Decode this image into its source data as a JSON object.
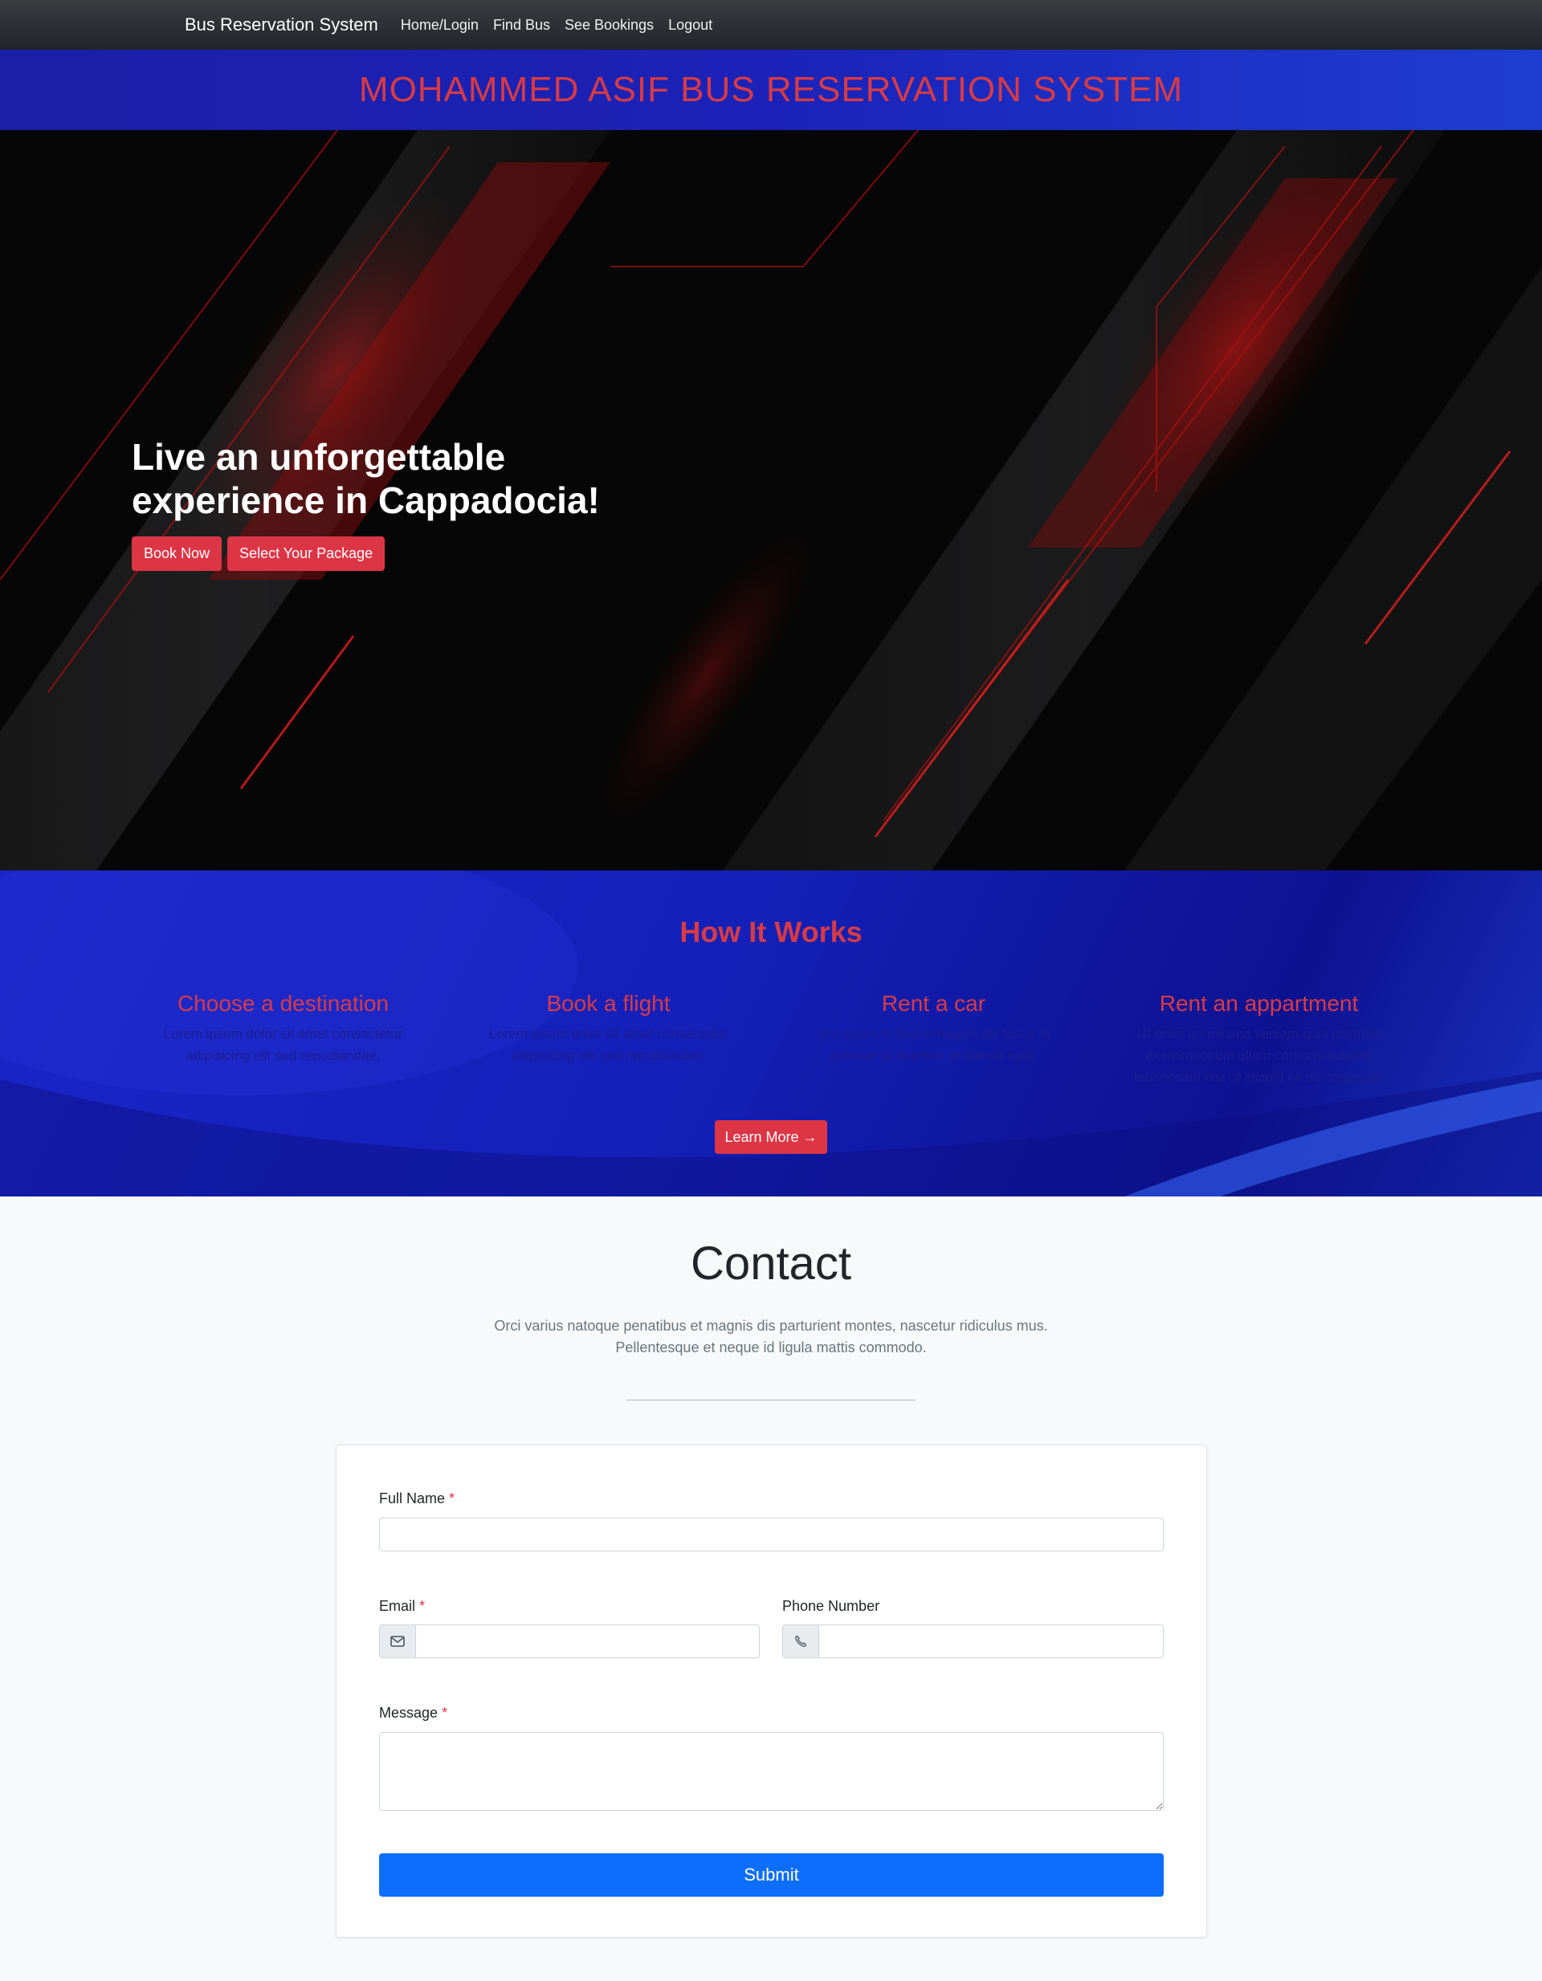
{
  "navbar": {
    "brand": "Bus Reservation System",
    "links": [
      "Home/Login",
      "Find Bus",
      "See Bookings",
      "Logout"
    ]
  },
  "banner": {
    "title": "MOHAMMED ASIF BUS RESERVATION SYSTEM"
  },
  "hero": {
    "headline": "Live an unforgettable experience in Cappadocia!",
    "book_now": "Book Now",
    "select_package": "Select Your Package"
  },
  "how": {
    "title": "How It Works",
    "steps": [
      {
        "title": "Choose a destination",
        "text": "Lorem ipsum dolor sit amet consectetur adipisicing elit sed repudiandae."
      },
      {
        "title": "Book a flight",
        "text": "Lorem ipsum dolor sit amet consectetur adipisicing elit sed repudiandae."
      },
      {
        "title": "Rent a car",
        "text": "Nisi quam in libero magnis dis fusce in quisque ut dapibus et blandit eget."
      },
      {
        "title": "Rent an appartment",
        "text": "Ut enim ad minima veniam quis nostrum exercitationem ullam corporis suscipit laboriosam nisi ut aliquid ex ea commodi."
      }
    ],
    "learn_more": "Learn More →"
  },
  "contact": {
    "title": "Contact",
    "subtitle_line1": "Orci varius natoque penatibus et magnis dis parturient montes, nascetur ridiculus mus.",
    "subtitle_line2": "Pellentesque et neque id ligula mattis commodo.",
    "full_name_label": "Full Name",
    "email_label": "Email",
    "phone_label": "Phone Number",
    "message_label": "Message",
    "required_mark": "*",
    "submit": "Submit"
  },
  "colors": {
    "accent_red": "#dc3545",
    "banner_blue": "#1c22b8",
    "submit_blue": "#0d6efd"
  }
}
